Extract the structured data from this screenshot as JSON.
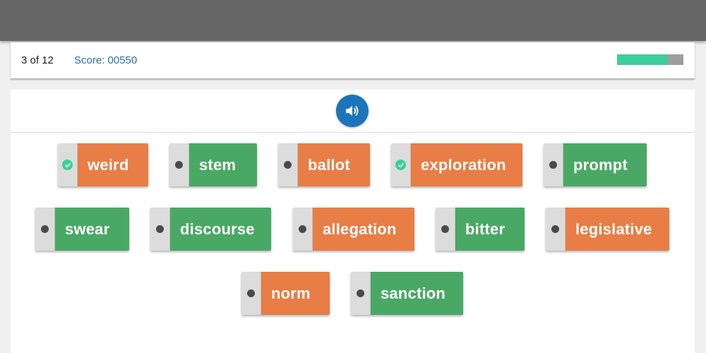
{
  "header": {
    "progress_text": "3 of 12",
    "score_text": "Score: 00550",
    "progress_fraction": 0.75,
    "progress_color": "#3ccf9b"
  },
  "audio": {
    "icon": "speaker-icon",
    "color": "#1b75bb"
  },
  "colors": {
    "orange": "#e87d45",
    "green": "#4aa865"
  },
  "tiles": [
    {
      "word": "weird",
      "color": "orange",
      "status": "checked"
    },
    {
      "word": "stem",
      "color": "green",
      "status": "unchecked"
    },
    {
      "word": "ballot",
      "color": "orange",
      "status": "unchecked"
    },
    {
      "word": "exploration",
      "color": "orange",
      "status": "checked"
    },
    {
      "word": "prompt",
      "color": "green",
      "status": "unchecked"
    },
    {
      "word": "swear",
      "color": "green",
      "status": "unchecked"
    },
    {
      "word": "discourse",
      "color": "green",
      "status": "unchecked"
    },
    {
      "word": "allegation",
      "color": "orange",
      "status": "unchecked"
    },
    {
      "word": "bitter",
      "color": "green",
      "status": "unchecked"
    },
    {
      "word": "legislative",
      "color": "orange",
      "status": "unchecked"
    },
    {
      "word": "norm",
      "color": "orange",
      "status": "unchecked"
    },
    {
      "word": "sanction",
      "color": "green",
      "status": "unchecked"
    }
  ]
}
